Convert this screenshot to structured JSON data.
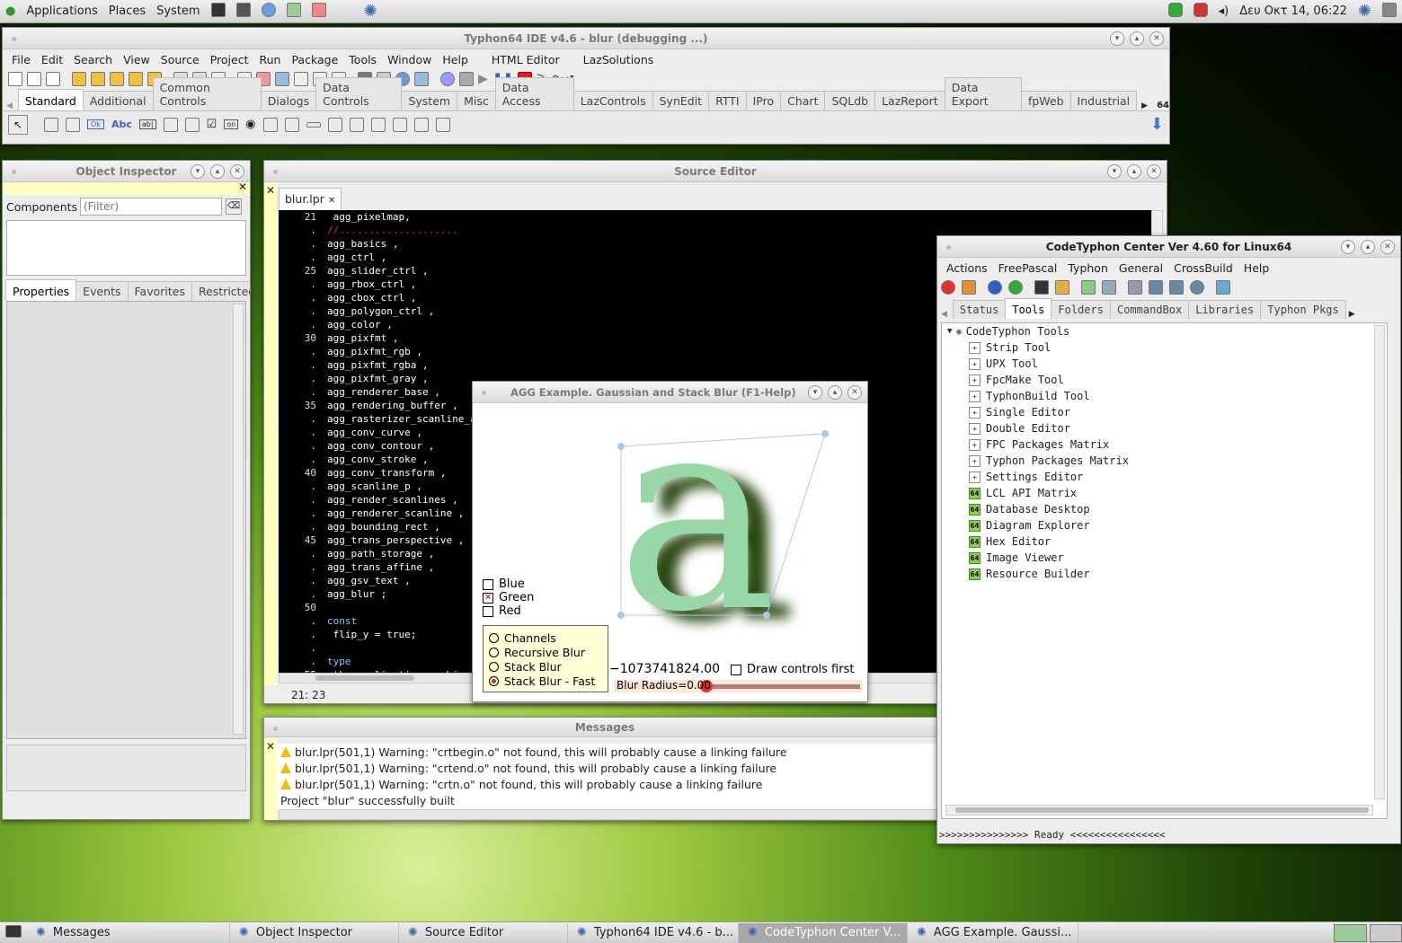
{
  "top_panel": {
    "menus": [
      "Applications",
      "Places",
      "System"
    ],
    "clock": "Δευ Οκτ 14, 06:22"
  },
  "ide": {
    "title": "Typhon64 IDE v4.6 - blur (debugging ...)",
    "menu": [
      "File",
      "Edit",
      "Search",
      "View",
      "Source",
      "Project",
      "Run",
      "Package",
      "Tools",
      "Window",
      "Help",
      "HTML Editor",
      "LazSolutions"
    ],
    "palette_tabs": [
      "Standard",
      "Additional",
      "Common Controls",
      "Dialogs",
      "Data Controls",
      "System",
      "Misc",
      "Data Access",
      "LazControls",
      "SynEdit",
      "RTTI",
      "IPro",
      "Chart",
      "SQLdb",
      "LazReport",
      "Data Export",
      "fpWeb",
      "Industrial"
    ],
    "component_labels": [
      "Ok",
      "Abc",
      "ab|",
      "on"
    ]
  },
  "object_inspector": {
    "title": "Object Inspector",
    "components_label": "Components",
    "filter_placeholder": "(Filter)",
    "tabs": [
      "Properties",
      "Events",
      "Favorites",
      "Restricted"
    ]
  },
  "source_editor": {
    "title": "Source Editor",
    "tab": "blur.lpr",
    "status": "21: 23",
    "lines": [
      {
        "n": "21",
        "t": " agg_pixelmap,",
        "c": "#fff"
      },
      {
        "n": ".",
        "t": "//....................",
        "c": "#e03030"
      },
      {
        "n": ".",
        "t": "agg_basics ,",
        "c": "#fff"
      },
      {
        "n": ".",
        "t": "agg_ctrl ,",
        "c": "#fff"
      },
      {
        "n": "25",
        "t": "agg_slider_ctrl ,",
        "c": "#fff"
      },
      {
        "n": ".",
        "t": "agg_rbox_ctrl ,",
        "c": "#fff"
      },
      {
        "n": ".",
        "t": "agg_cbox_ctrl ,",
        "c": "#fff"
      },
      {
        "n": ".",
        "t": "agg_polygon_ctrl ,",
        "c": "#fff"
      },
      {
        "n": ".",
        "t": "agg_color ,",
        "c": "#fff"
      },
      {
        "n": "30",
        "t": "agg_pixfmt ,",
        "c": "#fff"
      },
      {
        "n": ".",
        "t": "agg_pixfmt_rgb ,",
        "c": "#fff"
      },
      {
        "n": ".",
        "t": "agg_pixfmt_rgba ,",
        "c": "#fff"
      },
      {
        "n": ".",
        "t": "agg_pixfmt_gray ,",
        "c": "#fff"
      },
      {
        "n": ".",
        "t": "agg_renderer_base ,",
        "c": "#fff"
      },
      {
        "n": "35",
        "t": "agg_rendering_buffer ,",
        "c": "#fff"
      },
      {
        "n": ".",
        "t": "agg_rasterizer_scanline_aa ,",
        "c": "#fff"
      },
      {
        "n": ".",
        "t": "agg_conv_curve ,",
        "c": "#fff"
      },
      {
        "n": ".",
        "t": "agg_conv_contour ,",
        "c": "#fff"
      },
      {
        "n": ".",
        "t": "agg_conv_stroke ,",
        "c": "#fff"
      },
      {
        "n": "40",
        "t": "agg_conv_transform ,",
        "c": "#fff"
      },
      {
        "n": ".",
        "t": "agg_scanline_p ,",
        "c": "#fff"
      },
      {
        "n": ".",
        "t": "agg_render_scanlines ,",
        "c": "#fff"
      },
      {
        "n": ".",
        "t": "agg_renderer_scanline ,",
        "c": "#fff"
      },
      {
        "n": ".",
        "t": "agg_bounding_rect ,",
        "c": "#fff"
      },
      {
        "n": "45",
        "t": "agg_trans_perspective ,",
        "c": "#fff"
      },
      {
        "n": ".",
        "t": "agg_path_storage ,",
        "c": "#fff"
      },
      {
        "n": ".",
        "t": "agg_trans_affine ,",
        "c": "#fff"
      },
      {
        "n": ".",
        "t": "agg_gsv_text ,",
        "c": "#fff"
      },
      {
        "n": ".",
        "t": "agg_blur ;",
        "c": "#fff"
      },
      {
        "n": "50",
        "t": "",
        "c": "#fff"
      },
      {
        "n": ".",
        "t": "const",
        "c": "#7ec8ff"
      },
      {
        "n": ".",
        "t": " flip_y = true;",
        "c": "#fff"
      },
      {
        "n": ".",
        "t": "",
        "c": "#fff"
      },
      {
        "n": ".",
        "t": "type",
        "c": "#7ec8ff"
      },
      {
        "n": "55",
        "t": " the_application = object(platform_support )",
        "c": "#fff"
      }
    ]
  },
  "agg": {
    "title": "AGG Example. Gaussian and Stack Blur (F1-Help)",
    "checkboxes": [
      {
        "label": "Blue",
        "checked": false
      },
      {
        "label": "Green",
        "checked": true
      },
      {
        "label": "Red",
        "checked": false
      }
    ],
    "radios": [
      {
        "label": "Channels",
        "selected": false
      },
      {
        "label": "Recursive Blur",
        "selected": false
      },
      {
        "label": "Stack Blur",
        "selected": false
      },
      {
        "label": "Stack Blur - Fast",
        "selected": true
      }
    ],
    "number": "−1073741824.00",
    "draw_controls": "Draw controls first",
    "slider_label": "Blur Radius=0.00",
    "slider_value": 0.0,
    "glyph": "a"
  },
  "messages": {
    "title": "Messages",
    "items": [
      {
        "warn": true,
        "text": "blur.lpr(501,1) Warning: \"crtbegin.o\" not found, this will probably cause a linking failure"
      },
      {
        "warn": true,
        "text": "blur.lpr(501,1) Warning: \"crtend.o\" not found, this will probably cause a linking failure"
      },
      {
        "warn": true,
        "text": "blur.lpr(501,1) Warning: \"crtn.o\" not found, this will probably cause a linking failure"
      },
      {
        "warn": false,
        "text": "Project \"blur\" successfully built"
      }
    ]
  },
  "center": {
    "title": "CodeTyphon Center Ver 4.60 for Linux64",
    "menu": [
      "Actions",
      "FreePascal",
      "Typhon",
      "General",
      "CrossBuild",
      "Help"
    ],
    "tabs": [
      "Status",
      "Tools",
      "Folders",
      "CommandBox",
      "Libraries",
      "Typhon Pkgs"
    ],
    "root": "CodeTyphon Tools",
    "tools": [
      {
        "label": "Strip Tool",
        "g": false
      },
      {
        "label": "UPX Tool",
        "g": false
      },
      {
        "label": "FpcMake Tool",
        "g": false
      },
      {
        "label": "TyphonBuild Tool",
        "g": false
      },
      {
        "label": "Single Editor",
        "g": false
      },
      {
        "label": "Double Editor",
        "g": false
      },
      {
        "label": "FPC Packages Matrix",
        "g": false
      },
      {
        "label": "Typhon Packages Matrix",
        "g": false
      },
      {
        "label": "Settings Editor",
        "g": false
      },
      {
        "label": "LCL API Matrix",
        "g": true
      },
      {
        "label": "Database Desktop",
        "g": true
      },
      {
        "label": "Diagram Explorer",
        "g": true
      },
      {
        "label": "Hex Editor",
        "g": true
      },
      {
        "label": "Image Viewer",
        "g": true
      },
      {
        "label": "Resource Builder",
        "g": true
      }
    ],
    "status": ">>>>>>>>>>>>>>> Ready <<<<<<<<<<<<<<<<"
  },
  "taskbar": [
    "Messages",
    "Object Inspector",
    "Source Editor",
    "Typhon64 IDE v4.6 - b...",
    "CodeTyphon Center V...",
    "AGG Example. Gaussi..."
  ],
  "colors": {
    "editor_bg": "#000000",
    "selection": "#ffffc0",
    "accent": "#3a6ab0"
  }
}
